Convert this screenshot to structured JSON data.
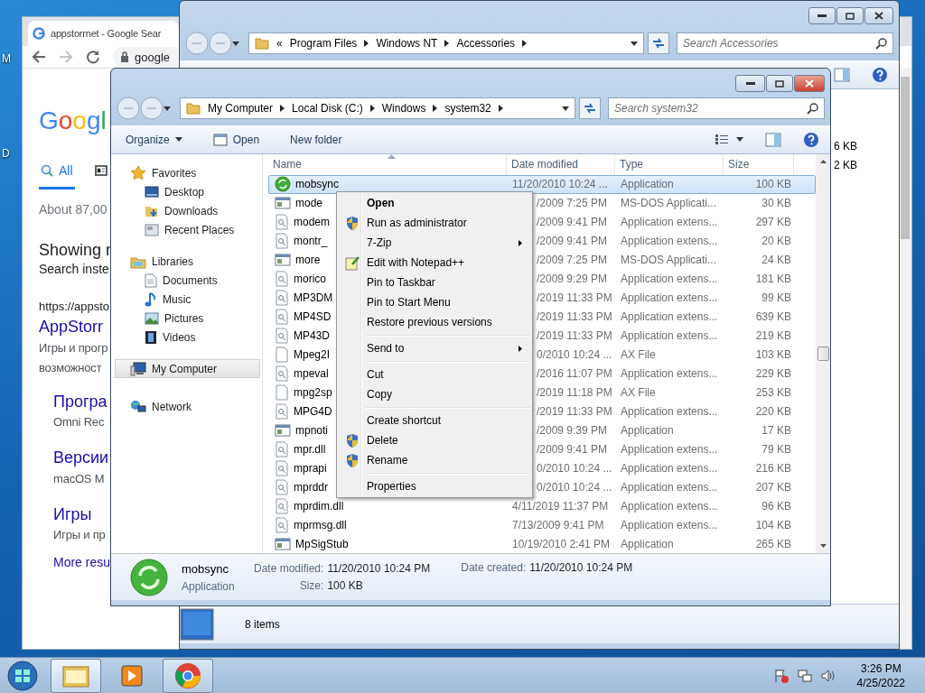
{
  "desktop": {
    "icons": [
      {
        "label": "M"
      },
      {
        "label": "D"
      }
    ]
  },
  "browser": {
    "tab_title": "appstorrnet - Google Sear",
    "address": "google",
    "forward_enabled": false,
    "logo": "Googl",
    "search_tabs": [
      {
        "label": "All",
        "selected": true
      },
      {
        "selected": false
      }
    ],
    "result_count": "About 87,00",
    "showing": "Showing r",
    "instead": "Search inste",
    "result": {
      "url": "https://appsto",
      "title": "AppStorr",
      "snippet_lines": [
        "Игры и прогр",
        "возможност"
      ],
      "sitelinks": [
        {
          "title": "Програ",
          "snippet": "Omni Rec"
        },
        {
          "title": "Версии",
          "snippet": "macOS M"
        },
        {
          "title": "Игры",
          "snippet": "Игры и пр"
        }
      ],
      "more": "More resu"
    }
  },
  "back_explorer": {
    "overflow": "«",
    "path": [
      "Program Files",
      "Windows NT",
      "Accessories"
    ],
    "search_placeholder": "Search Accessories",
    "sizes": [
      "6 KB",
      "2 KB"
    ],
    "status": "8 items"
  },
  "front_explorer": {
    "path": [
      "My Computer",
      "Local Disk (C:)",
      "Windows",
      "system32"
    ],
    "search_placeholder": "Search system32",
    "toolbar": [
      {
        "label": "Organize",
        "kind": "menu"
      },
      {
        "label": "Open",
        "kind": "icon"
      },
      {
        "label": "New folder",
        "kind": "plain"
      }
    ],
    "nav": [
      {
        "label": "Favorites",
        "kind": "favorites",
        "selected": false,
        "children": [
          {
            "label": "Desktop",
            "kind": "desktop",
            "selected": false
          },
          {
            "label": "Downloads",
            "kind": "downloads",
            "selected": false
          },
          {
            "label": "Recent Places",
            "kind": "recent",
            "selected": false
          }
        ]
      },
      {
        "label": "Libraries",
        "kind": "libraries",
        "selected": false,
        "children": [
          {
            "label": "Documents",
            "kind": "documents",
            "selected": false
          },
          {
            "label": "Music",
            "kind": "music",
            "selected": false
          },
          {
            "label": "Pictures",
            "kind": "pictures",
            "selected": false
          },
          {
            "label": "Videos",
            "kind": "videos",
            "selected": false
          }
        ]
      },
      {
        "label": "My Computer",
        "kind": "computer",
        "selected": true
      },
      {
        "label": "Network",
        "kind": "network",
        "selected": false
      }
    ],
    "columns": [
      {
        "label": "Name",
        "sorted": true
      },
      {
        "label": "Date modified",
        "sorted": false
      },
      {
        "label": "Type",
        "sorted": false
      },
      {
        "label": "Size",
        "sorted": false
      }
    ],
    "rows": [
      {
        "name": "mobsync",
        "date": "11/20/2010 10:24 ...",
        "type": "Application",
        "size": "100 KB",
        "kind": "sync",
        "selected": true
      },
      {
        "name": "mode",
        "date": "/2009 7:25 PM",
        "type": "MS-DOS Applicati...",
        "size": "30 KB",
        "kind": "app",
        "selected": false
      },
      {
        "name": "modem",
        "date": "/2009 9:41 PM",
        "type": "Application extens...",
        "size": "297 KB",
        "kind": "dll",
        "selected": false
      },
      {
        "name": "montr_",
        "date": "/2009 9:41 PM",
        "type": "Application extens...",
        "size": "20 KB",
        "kind": "dll",
        "selected": false
      },
      {
        "name": "more",
        "date": "/2009 7:25 PM",
        "type": "MS-DOS Applicati...",
        "size": "24 KB",
        "kind": "app",
        "selected": false
      },
      {
        "name": "morico",
        "date": "/2009 9:29 PM",
        "type": "Application extens...",
        "size": "181 KB",
        "kind": "dll",
        "selected": false
      },
      {
        "name": "MP3DM",
        "date": "/2019 11:33 PM",
        "type": "Application extens...",
        "size": "99 KB",
        "kind": "dll",
        "selected": false
      },
      {
        "name": "MP4SD",
        "date": "/2019 11:33 PM",
        "type": "Application extens...",
        "size": "639 KB",
        "kind": "dll",
        "selected": false
      },
      {
        "name": "MP43D",
        "date": "/2019 11:33 PM",
        "type": "Application extens...",
        "size": "219 KB",
        "kind": "dll",
        "selected": false
      },
      {
        "name": "Mpeg2I",
        "date": "0/2010 10:24 ...",
        "type": "AX File",
        "size": "103 KB",
        "kind": "blank",
        "selected": false
      },
      {
        "name": "mpeval",
        "date": "/2016 11:07 PM",
        "type": "Application extens...",
        "size": "229 KB",
        "kind": "dll",
        "selected": false
      },
      {
        "name": "mpg2sp",
        "date": "/2019 11:18 PM",
        "type": "AX File",
        "size": "253 KB",
        "kind": "blank",
        "selected": false
      },
      {
        "name": "MPG4D",
        "date": "/2019 11:33 PM",
        "type": "Application extens...",
        "size": "220 KB",
        "kind": "dll",
        "selected": false
      },
      {
        "name": "mpnoti",
        "date": "/2009 9:39 PM",
        "type": "Application",
        "size": "17 KB",
        "kind": "app",
        "selected": false
      },
      {
        "name": "mpr.dll",
        "date": "/2009 9:41 PM",
        "type": "Application extens...",
        "size": "79 KB",
        "kind": "dll",
        "selected": false
      },
      {
        "name": "mprapi",
        "date": "0/2010 10:24 ...",
        "type": "Application extens...",
        "size": "216 KB",
        "kind": "dll",
        "selected": false
      },
      {
        "name": "mprddr",
        "date": "0/2010 10:24 ...",
        "type": "Application extens...",
        "size": "207 KB",
        "kind": "dll",
        "selected": false
      },
      {
        "name": "mprdim.dll",
        "date": "4/11/2019 11:37 PM",
        "type": "Application extens...",
        "size": "96 KB",
        "kind": "dll",
        "selected": false
      },
      {
        "name": "mprmsg.dll",
        "date": "7/13/2009 9:41 PM",
        "type": "Application extens...",
        "size": "104 KB",
        "kind": "dll",
        "selected": false
      },
      {
        "name": "MpSigStub",
        "date": "10/19/2010 2:41 PM",
        "type": "Application",
        "size": "265 KB",
        "kind": "app",
        "selected": false
      }
    ],
    "details": {
      "name": "mobsync",
      "type": "Application",
      "fields": [
        {
          "label": "Date modified:",
          "value": "11/20/2010 10:24 PM"
        },
        {
          "label": "Size:",
          "value": "100 KB"
        },
        {
          "label": "Date created:",
          "value": "11/20/2010 10:24 PM"
        }
      ]
    },
    "context_menu": [
      {
        "kind": "item",
        "label": "Open",
        "default": true,
        "submenu": false
      },
      {
        "kind": "item",
        "label": "Run as administrator",
        "default": false,
        "submenu": false
      },
      {
        "kind": "item",
        "label": "7-Zip",
        "default": false,
        "submenu": true
      },
      {
        "kind": "item",
        "label": "Edit with Notepad++",
        "default": false,
        "submenu": false
      },
      {
        "kind": "item",
        "label": "Pin to Taskbar",
        "default": false,
        "submenu": false
      },
      {
        "kind": "item",
        "label": "Pin to Start Menu",
        "default": false,
        "submenu": false
      },
      {
        "kind": "item",
        "label": "Restore previous versions",
        "default": false,
        "submenu": false
      },
      {
        "kind": "separator"
      },
      {
        "kind": "item",
        "label": "Send to",
        "default": false,
        "submenu": true
      },
      {
        "kind": "separator"
      },
      {
        "kind": "item",
        "label": "Cut",
        "default": false,
        "submenu": false
      },
      {
        "kind": "item",
        "label": "Copy",
        "default": false,
        "submenu": false
      },
      {
        "kind": "separator"
      },
      {
        "kind": "item",
        "label": "Create shortcut",
        "default": false,
        "submenu": false
      },
      {
        "kind": "item",
        "label": "Delete",
        "default": false,
        "submenu": false
      },
      {
        "kind": "item",
        "label": "Rename",
        "default": false,
        "submenu": false
      },
      {
        "kind": "separator"
      },
      {
        "kind": "item",
        "label": "Properties",
        "default": false,
        "submenu": false
      }
    ]
  },
  "taskbar": {
    "apps": [
      {
        "kind": "explorer",
        "running": true,
        "active": true
      },
      {
        "kind": "media",
        "running": false,
        "active": false
      },
      {
        "kind": "chrome",
        "running": true,
        "active": false
      }
    ],
    "clock": {
      "time": "3:26 PM",
      "date": "4/25/2022"
    }
  }
}
